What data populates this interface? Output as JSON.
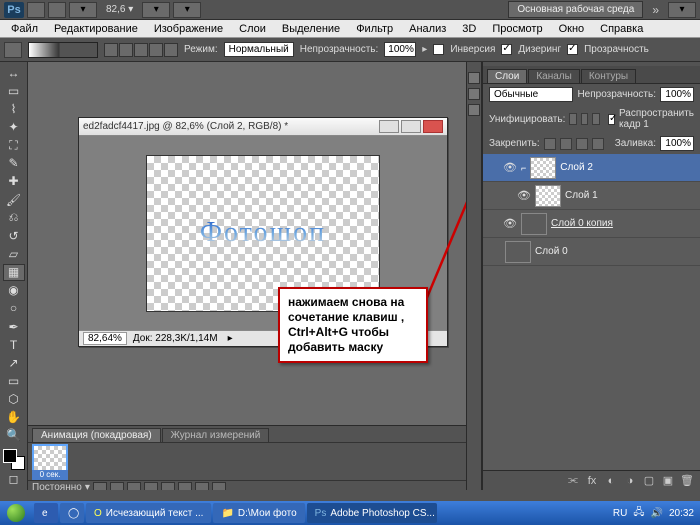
{
  "topbar": {
    "app": "Ps",
    "zoom": "82,6",
    "workspace": "Основная рабочая среда"
  },
  "menu": [
    "Файл",
    "Редактирование",
    "Изображение",
    "Слои",
    "Выделение",
    "Фильтр",
    "Анализ",
    "3D",
    "Просмотр",
    "Окно",
    "Справка"
  ],
  "options": {
    "mode_label": "Режим:",
    "mode_value": "Нормальный",
    "opacity_label": "Непрозрачность:",
    "opacity_value": "100%",
    "cb1": "Инверсия",
    "cb2": "Дизеринг",
    "cb3": "Прозрачность"
  },
  "doc": {
    "title": "ed2fadcf4417.jpg @ 82,6% (Слой 2, RGB/8) *",
    "zoom_status": "82,64%",
    "info": "Док: 228,3K/1,14M",
    "art_text": "Фотошоп"
  },
  "callout": "нажимаем снова на сочетание клавиш , Ctrl+Alt+G  чтобы добавить маску",
  "anim": {
    "tab1": "Анимация (покадровая)",
    "tab2": "Журнал измерений",
    "frame_label": "0 сек.",
    "loop": "Постоянно"
  },
  "layers_panel": {
    "tabs": [
      "Слои",
      "Каналы",
      "Контуры"
    ],
    "blend": "Обычные",
    "opacity_label": "Непрозрачность:",
    "opacity": "100%",
    "unify": "Унифицировать:",
    "propagate": "Распространить кадр 1",
    "lock": "Закрепить:",
    "fill_label": "Заливка:",
    "fill": "100%",
    "layers": [
      {
        "name": "Слой 2",
        "sel": true,
        "thumb": "chk"
      },
      {
        "name": "Слой 1",
        "sel": false,
        "thumb": "chk"
      },
      {
        "name": "Слой 0 копия",
        "sel": false,
        "thumb": "sky",
        "ul": true
      },
      {
        "name": "Слой 0",
        "sel": false,
        "thumb": "sky"
      }
    ]
  },
  "taskbar": {
    "items": [
      "",
      "",
      "Исчезающий текст ...",
      "D:\\Мои фото",
      "Adobe Photoshop CS..."
    ],
    "lang": "RU",
    "time": "20:32"
  }
}
